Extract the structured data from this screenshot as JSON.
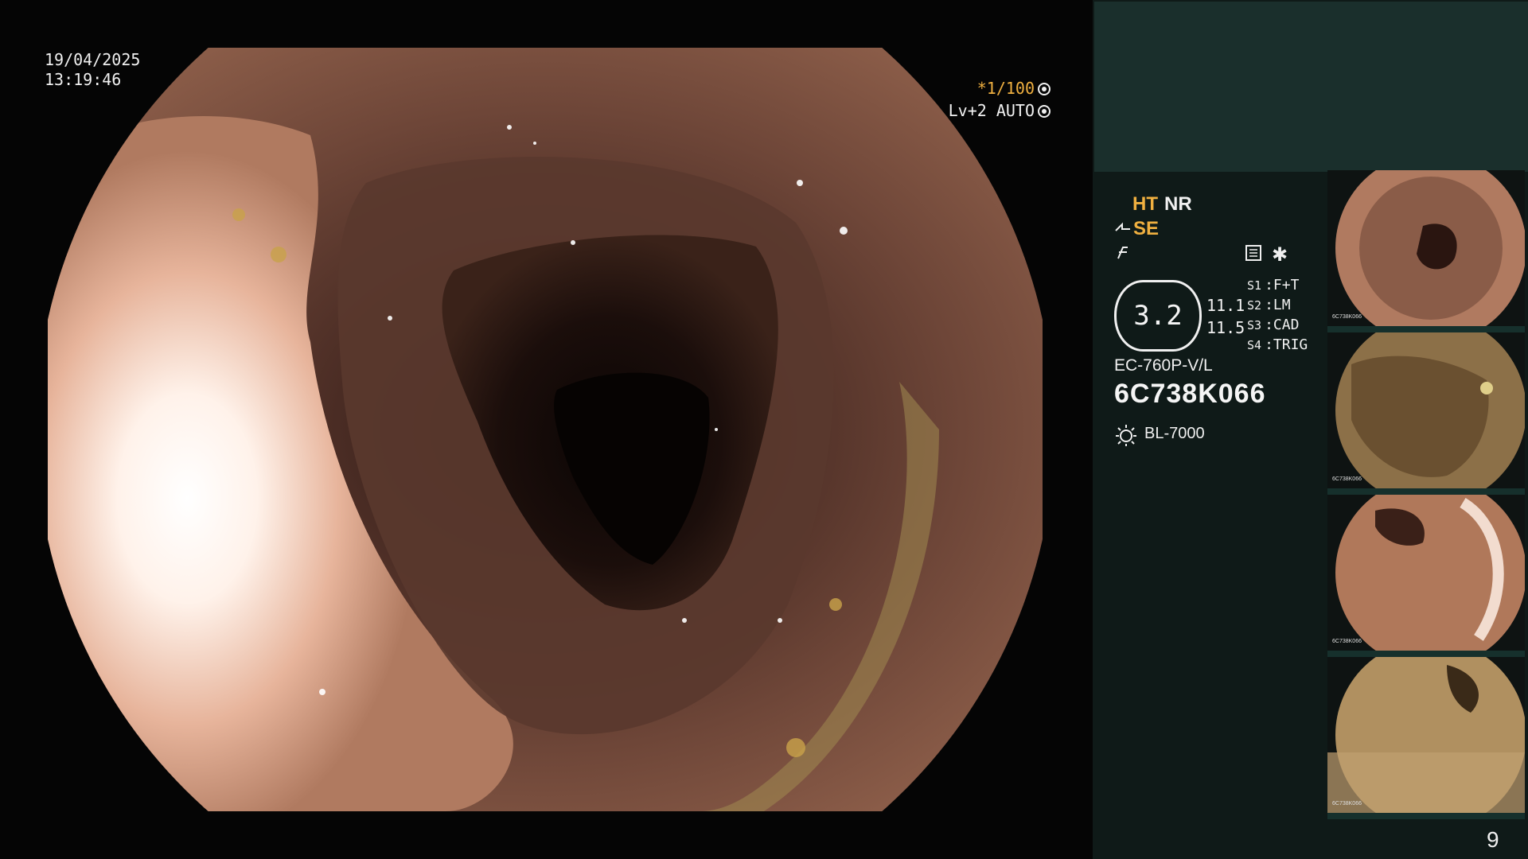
{
  "overlay": {
    "date": "19/04/2025",
    "time": "13:19:46",
    "shutter": "*1/100",
    "level_mode": "Lv+2 AUTO"
  },
  "right_panel": {
    "mode_ht": "HT",
    "mode_nr": "NR",
    "mode_se": "SE",
    "level_value": "3.2",
    "value_1": "11.1",
    "value_2": "11.5",
    "switches": [
      {
        "key": "S1",
        "value": "F+T"
      },
      {
        "key": "S2",
        "value": "LM"
      },
      {
        "key": "S3",
        "value": "CAD"
      },
      {
        "key": "S4",
        "value": "TRIG"
      }
    ],
    "scope_model": "EC-760P-V/L",
    "scope_serial": "6C738K066",
    "light_source": "BL-7000",
    "page_number": "9"
  },
  "thumbnails": [
    {
      "serial": "6C738K066"
    },
    {
      "serial": "6C738K066"
    },
    {
      "serial": "6C738K066"
    },
    {
      "serial": "6C738K066"
    }
  ],
  "colors": {
    "amber": "#f0b040",
    "panel_bg": "#0f1a18",
    "panel_top": "#1a2f2c"
  }
}
